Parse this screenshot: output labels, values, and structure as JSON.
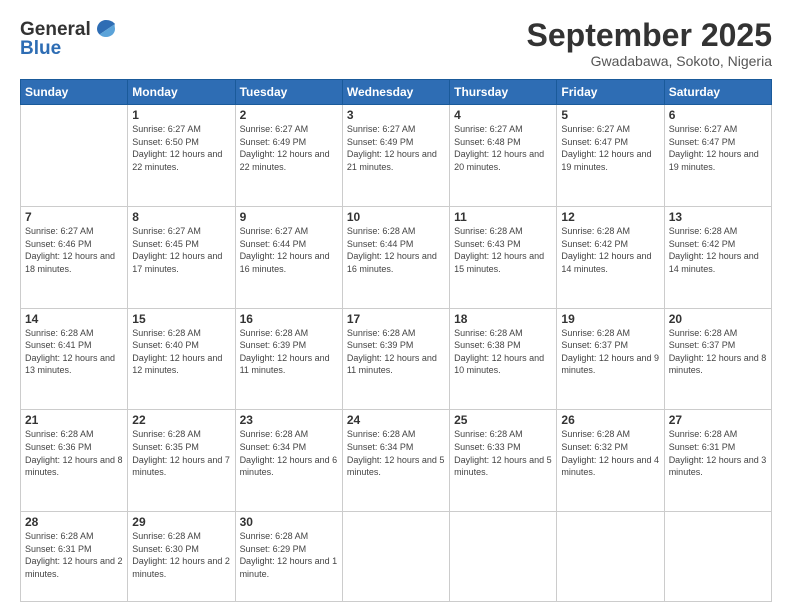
{
  "header": {
    "logo_line1": "General",
    "logo_line2": "Blue",
    "month": "September 2025",
    "location": "Gwadabawa, Sokoto, Nigeria"
  },
  "weekdays": [
    "Sunday",
    "Monday",
    "Tuesday",
    "Wednesday",
    "Thursday",
    "Friday",
    "Saturday"
  ],
  "weeks": [
    [
      {
        "day": "",
        "sunrise": "",
        "sunset": "",
        "daylight": ""
      },
      {
        "day": "1",
        "sunrise": "Sunrise: 6:27 AM",
        "sunset": "Sunset: 6:50 PM",
        "daylight": "Daylight: 12 hours and 22 minutes."
      },
      {
        "day": "2",
        "sunrise": "Sunrise: 6:27 AM",
        "sunset": "Sunset: 6:49 PM",
        "daylight": "Daylight: 12 hours and 22 minutes."
      },
      {
        "day": "3",
        "sunrise": "Sunrise: 6:27 AM",
        "sunset": "Sunset: 6:49 PM",
        "daylight": "Daylight: 12 hours and 21 minutes."
      },
      {
        "day": "4",
        "sunrise": "Sunrise: 6:27 AM",
        "sunset": "Sunset: 6:48 PM",
        "daylight": "Daylight: 12 hours and 20 minutes."
      },
      {
        "day": "5",
        "sunrise": "Sunrise: 6:27 AM",
        "sunset": "Sunset: 6:47 PM",
        "daylight": "Daylight: 12 hours and 19 minutes."
      },
      {
        "day": "6",
        "sunrise": "Sunrise: 6:27 AM",
        "sunset": "Sunset: 6:47 PM",
        "daylight": "Daylight: 12 hours and 19 minutes."
      }
    ],
    [
      {
        "day": "7",
        "sunrise": "Sunrise: 6:27 AM",
        "sunset": "Sunset: 6:46 PM",
        "daylight": "Daylight: 12 hours and 18 minutes."
      },
      {
        "day": "8",
        "sunrise": "Sunrise: 6:27 AM",
        "sunset": "Sunset: 6:45 PM",
        "daylight": "Daylight: 12 hours and 17 minutes."
      },
      {
        "day": "9",
        "sunrise": "Sunrise: 6:27 AM",
        "sunset": "Sunset: 6:44 PM",
        "daylight": "Daylight: 12 hours and 16 minutes."
      },
      {
        "day": "10",
        "sunrise": "Sunrise: 6:28 AM",
        "sunset": "Sunset: 6:44 PM",
        "daylight": "Daylight: 12 hours and 16 minutes."
      },
      {
        "day": "11",
        "sunrise": "Sunrise: 6:28 AM",
        "sunset": "Sunset: 6:43 PM",
        "daylight": "Daylight: 12 hours and 15 minutes."
      },
      {
        "day": "12",
        "sunrise": "Sunrise: 6:28 AM",
        "sunset": "Sunset: 6:42 PM",
        "daylight": "Daylight: 12 hours and 14 minutes."
      },
      {
        "day": "13",
        "sunrise": "Sunrise: 6:28 AM",
        "sunset": "Sunset: 6:42 PM",
        "daylight": "Daylight: 12 hours and 14 minutes."
      }
    ],
    [
      {
        "day": "14",
        "sunrise": "Sunrise: 6:28 AM",
        "sunset": "Sunset: 6:41 PM",
        "daylight": "Daylight: 12 hours and 13 minutes."
      },
      {
        "day": "15",
        "sunrise": "Sunrise: 6:28 AM",
        "sunset": "Sunset: 6:40 PM",
        "daylight": "Daylight: 12 hours and 12 minutes."
      },
      {
        "day": "16",
        "sunrise": "Sunrise: 6:28 AM",
        "sunset": "Sunset: 6:39 PM",
        "daylight": "Daylight: 12 hours and 11 minutes."
      },
      {
        "day": "17",
        "sunrise": "Sunrise: 6:28 AM",
        "sunset": "Sunset: 6:39 PM",
        "daylight": "Daylight: 12 hours and 11 minutes."
      },
      {
        "day": "18",
        "sunrise": "Sunrise: 6:28 AM",
        "sunset": "Sunset: 6:38 PM",
        "daylight": "Daylight: 12 hours and 10 minutes."
      },
      {
        "day": "19",
        "sunrise": "Sunrise: 6:28 AM",
        "sunset": "Sunset: 6:37 PM",
        "daylight": "Daylight: 12 hours and 9 minutes."
      },
      {
        "day": "20",
        "sunrise": "Sunrise: 6:28 AM",
        "sunset": "Sunset: 6:37 PM",
        "daylight": "Daylight: 12 hours and 8 minutes."
      }
    ],
    [
      {
        "day": "21",
        "sunrise": "Sunrise: 6:28 AM",
        "sunset": "Sunset: 6:36 PM",
        "daylight": "Daylight: 12 hours and 8 minutes."
      },
      {
        "day": "22",
        "sunrise": "Sunrise: 6:28 AM",
        "sunset": "Sunset: 6:35 PM",
        "daylight": "Daylight: 12 hours and 7 minutes."
      },
      {
        "day": "23",
        "sunrise": "Sunrise: 6:28 AM",
        "sunset": "Sunset: 6:34 PM",
        "daylight": "Daylight: 12 hours and 6 minutes."
      },
      {
        "day": "24",
        "sunrise": "Sunrise: 6:28 AM",
        "sunset": "Sunset: 6:34 PM",
        "daylight": "Daylight: 12 hours and 5 minutes."
      },
      {
        "day": "25",
        "sunrise": "Sunrise: 6:28 AM",
        "sunset": "Sunset: 6:33 PM",
        "daylight": "Daylight: 12 hours and 5 minutes."
      },
      {
        "day": "26",
        "sunrise": "Sunrise: 6:28 AM",
        "sunset": "Sunset: 6:32 PM",
        "daylight": "Daylight: 12 hours and 4 minutes."
      },
      {
        "day": "27",
        "sunrise": "Sunrise: 6:28 AM",
        "sunset": "Sunset: 6:31 PM",
        "daylight": "Daylight: 12 hours and 3 minutes."
      }
    ],
    [
      {
        "day": "28",
        "sunrise": "Sunrise: 6:28 AM",
        "sunset": "Sunset: 6:31 PM",
        "daylight": "Daylight: 12 hours and 2 minutes."
      },
      {
        "day": "29",
        "sunrise": "Sunrise: 6:28 AM",
        "sunset": "Sunset: 6:30 PM",
        "daylight": "Daylight: 12 hours and 2 minutes."
      },
      {
        "day": "30",
        "sunrise": "Sunrise: 6:28 AM",
        "sunset": "Sunset: 6:29 PM",
        "daylight": "Daylight: 12 hours and 1 minute."
      },
      {
        "day": "",
        "sunrise": "",
        "sunset": "",
        "daylight": ""
      },
      {
        "day": "",
        "sunrise": "",
        "sunset": "",
        "daylight": ""
      },
      {
        "day": "",
        "sunrise": "",
        "sunset": "",
        "daylight": ""
      },
      {
        "day": "",
        "sunrise": "",
        "sunset": "",
        "daylight": ""
      }
    ]
  ]
}
